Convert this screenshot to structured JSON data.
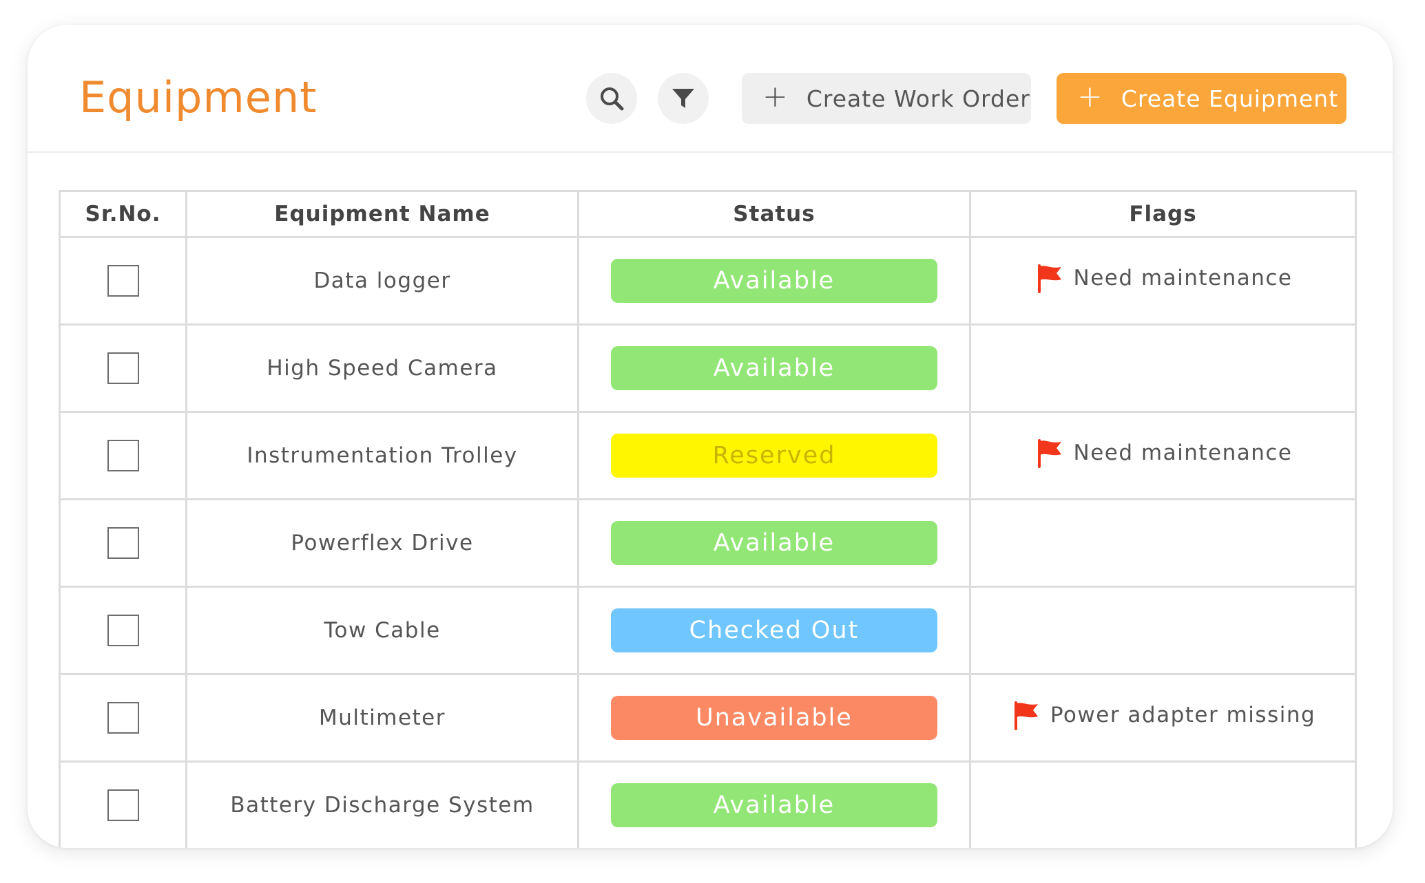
{
  "header": {
    "title": "Equipment",
    "search_icon": "search-icon",
    "filter_icon": "filter-icon",
    "create_work_order_label": "Create Work Order",
    "create_equipment_label": "Create Equipment",
    "plus_glyph": "+"
  },
  "colors": {
    "title": "#ef8a2e",
    "primary_button": "#fba63b",
    "status_available": "#92e676",
    "status_reserved": "#fff600",
    "status_checked_out": "#70c6fe",
    "status_unavailable": "#fb8a64",
    "flag": "#f2361c"
  },
  "table": {
    "columns": [
      "Sr.No.",
      "Equipment Name",
      "Status",
      "Flags"
    ],
    "rows": [
      {
        "name": "Data logger",
        "status": "Available",
        "status_type": "available",
        "flag": "Need maintenance"
      },
      {
        "name": "High Speed Camera",
        "status": "Available",
        "status_type": "available",
        "flag": ""
      },
      {
        "name": "Instrumentation Trolley",
        "status": "Reserved",
        "status_type": "reserved",
        "flag": "Need maintenance"
      },
      {
        "name": "Powerflex Drive",
        "status": "Available",
        "status_type": "available",
        "flag": ""
      },
      {
        "name": "Tow Cable",
        "status": "Checked Out",
        "status_type": "checked_out",
        "flag": ""
      },
      {
        "name": "Multimeter",
        "status": "Unavailable",
        "status_type": "unavailable",
        "flag": "Power adapter missing"
      },
      {
        "name": "Battery Discharge System",
        "status": "Available",
        "status_type": "available",
        "flag": ""
      }
    ]
  }
}
